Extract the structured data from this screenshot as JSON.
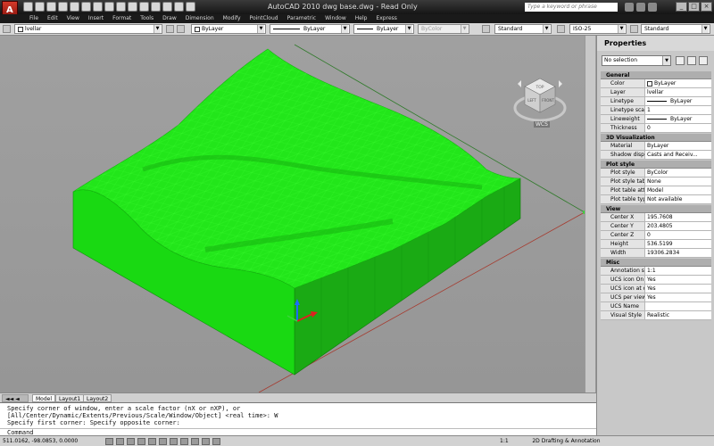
{
  "window": {
    "title": "AutoCAD 2010    dwg base.dwg - Read Only",
    "search_placeholder": "Type a keyword or phrase"
  },
  "menus": [
    "File",
    "Edit",
    "View",
    "Insert",
    "Format",
    "Tools",
    "Draw",
    "Dimension",
    "Modify",
    "PointCloud",
    "Parametric",
    "Window",
    "Help",
    "Express"
  ],
  "toolbar": {
    "layer": "lvellar",
    "color": "ByLayer",
    "linetype": "ByLayer",
    "lineweight": "ByLayer",
    "plotstyle": "ByColor",
    "text_style": "Standard",
    "dim_style": "ISO-25",
    "table_style": "Standard"
  },
  "viewport": {
    "wcs_label": "WCS",
    "viewcube_faces": {
      "top": "TOP",
      "left": "LEFT",
      "right": "FRONT"
    },
    "terrain_color": "#22e61a"
  },
  "layout_tabs": [
    "Model",
    "Layout1",
    "Layout2"
  ],
  "command": {
    "lines": [
      "Specify corner of window, enter a scale factor (nX or nXP), or",
      "[All/Center/Dynamic/Extents/Previous/Scale/Window/Object] <real time>: W",
      "Specify first corner: Specify opposite corner:"
    ],
    "prompt": "Command"
  },
  "status": {
    "coords": "511.0162, -98.0853, 0.0000",
    "scale": "1:1",
    "workspace": "2D Drafting & Annotation"
  },
  "properties": {
    "title": "Properties",
    "selection": "No selection",
    "sections": [
      {
        "name": "General",
        "rows": [
          {
            "k": "Color",
            "v": "ByLayer"
          },
          {
            "k": "Layer",
            "v": "lvellar"
          },
          {
            "k": "Linetype",
            "v": "ByLayer"
          },
          {
            "k": "Linetype scale",
            "v": "1"
          },
          {
            "k": "Lineweight",
            "v": "ByLayer"
          },
          {
            "k": "Thickness",
            "v": "0"
          }
        ]
      },
      {
        "name": "3D Visualization",
        "rows": [
          {
            "k": "Material",
            "v": "ByLayer"
          },
          {
            "k": "Shadow display",
            "v": "Casts and Receiv..."
          }
        ]
      },
      {
        "name": "Plot style",
        "rows": [
          {
            "k": "Plot style",
            "v": "ByColor"
          },
          {
            "k": "Plot style table",
            "v": "None"
          },
          {
            "k": "Plot table attac...",
            "v": "Model"
          },
          {
            "k": "Plot table type",
            "v": "Not available"
          }
        ]
      },
      {
        "name": "View",
        "rows": [
          {
            "k": "Center X",
            "v": "195.7608"
          },
          {
            "k": "Center Y",
            "v": "203.4805"
          },
          {
            "k": "Center Z",
            "v": "0"
          },
          {
            "k": "Height",
            "v": "536.5199"
          },
          {
            "k": "Width",
            "v": "19306.2834"
          }
        ]
      },
      {
        "name": "Misc",
        "rows": [
          {
            "k": "Annotation scale",
            "v": "1:1"
          },
          {
            "k": "UCS icon On",
            "v": "Yes"
          },
          {
            "k": "UCS icon at origin",
            "v": "Yes"
          },
          {
            "k": "UCS per viewport",
            "v": "Yes"
          },
          {
            "k": "UCS Name",
            "v": ""
          },
          {
            "k": "Visual Style",
            "v": "Realistic"
          }
        ]
      }
    ]
  }
}
